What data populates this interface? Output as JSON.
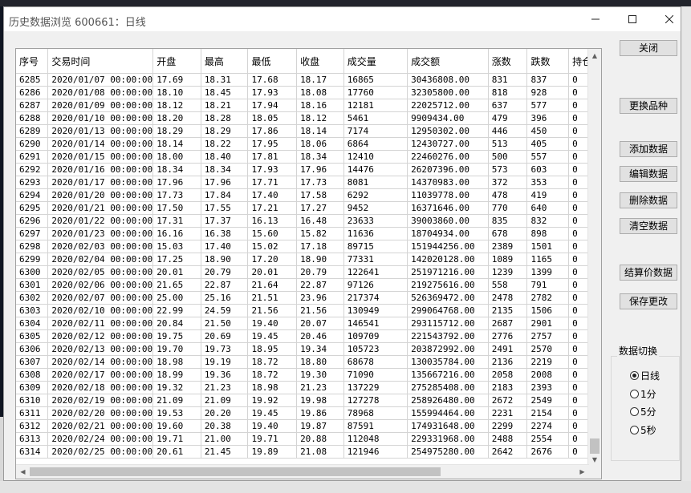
{
  "window": {
    "title": "历史数据浏览 600661：日线",
    "minimize_icon": "minimize-icon",
    "maximize_icon": "maximize-icon",
    "close_icon": "close-icon"
  },
  "table": {
    "columns": [
      "序号",
      "交易时间",
      "开盘",
      "最高",
      "最低",
      "收盘",
      "成交量",
      "成交额",
      "涨数",
      "跌数",
      "持仓"
    ],
    "rows": [
      [
        "6285",
        "2020/01/07 00:00:00",
        "17.69",
        "18.31",
        "17.68",
        "18.17",
        "16865",
        "30436808.00",
        "831",
        "837",
        "0"
      ],
      [
        "6286",
        "2020/01/08 00:00:00",
        "18.10",
        "18.45",
        "17.93",
        "18.08",
        "17760",
        "32305800.00",
        "818",
        "928",
        "0"
      ],
      [
        "6287",
        "2020/01/09 00:00:00",
        "18.12",
        "18.21",
        "17.94",
        "18.16",
        "12181",
        "22025712.00",
        "637",
        "577",
        "0"
      ],
      [
        "6288",
        "2020/01/10 00:00:00",
        "18.20",
        "18.28",
        "18.05",
        "18.12",
        "5461",
        "9909434.00",
        "479",
        "396",
        "0"
      ],
      [
        "6289",
        "2020/01/13 00:00:00",
        "18.29",
        "18.29",
        "17.86",
        "18.14",
        "7174",
        "12950302.00",
        "446",
        "450",
        "0"
      ],
      [
        "6290",
        "2020/01/14 00:00:00",
        "18.14",
        "18.22",
        "17.95",
        "18.06",
        "6864",
        "12430727.00",
        "513",
        "405",
        "0"
      ],
      [
        "6291",
        "2020/01/15 00:00:00",
        "18.00",
        "18.40",
        "17.81",
        "18.34",
        "12410",
        "22460276.00",
        "500",
        "557",
        "0"
      ],
      [
        "6292",
        "2020/01/16 00:00:00",
        "18.34",
        "18.34",
        "17.93",
        "17.96",
        "14476",
        "26207396.00",
        "573",
        "603",
        "0"
      ],
      [
        "6293",
        "2020/01/17 00:00:00",
        "17.96",
        "17.96",
        "17.71",
        "17.73",
        "8081",
        "14370983.00",
        "372",
        "353",
        "0"
      ],
      [
        "6294",
        "2020/01/20 00:00:00",
        "17.73",
        "17.84",
        "17.40",
        "17.58",
        "6292",
        "11039778.00",
        "478",
        "419",
        "0"
      ],
      [
        "6295",
        "2020/01/21 00:00:00",
        "17.50",
        "17.55",
        "17.21",
        "17.27",
        "9452",
        "16371646.00",
        "770",
        "640",
        "0"
      ],
      [
        "6296",
        "2020/01/22 00:00:00",
        "17.31",
        "17.37",
        "16.13",
        "16.48",
        "23633",
        "39003860.00",
        "835",
        "832",
        "0"
      ],
      [
        "6297",
        "2020/01/23 00:00:00",
        "16.16",
        "16.38",
        "15.60",
        "15.82",
        "11636",
        "18704934.00",
        "678",
        "898",
        "0"
      ],
      [
        "6298",
        "2020/02/03 00:00:00",
        "15.03",
        "17.40",
        "15.02",
        "17.18",
        "89715",
        "151944256.00",
        "2389",
        "1501",
        "0"
      ],
      [
        "6299",
        "2020/02/04 00:00:00",
        "17.25",
        "18.90",
        "17.20",
        "18.90",
        "77331",
        "142020128.00",
        "1089",
        "1165",
        "0"
      ],
      [
        "6300",
        "2020/02/05 00:00:00",
        "20.01",
        "20.79",
        "20.01",
        "20.79",
        "122641",
        "251971216.00",
        "1239",
        "1399",
        "0"
      ],
      [
        "6301",
        "2020/02/06 00:00:00",
        "21.65",
        "22.87",
        "21.64",
        "22.87",
        "97126",
        "219275616.00",
        "558",
        "791",
        "0"
      ],
      [
        "6302",
        "2020/02/07 00:00:00",
        "25.00",
        "25.16",
        "21.51",
        "23.96",
        "217374",
        "526369472.00",
        "2478",
        "2782",
        "0"
      ],
      [
        "6303",
        "2020/02/10 00:00:00",
        "22.99",
        "24.59",
        "21.56",
        "21.56",
        "130949",
        "299064768.00",
        "2135",
        "1506",
        "0"
      ],
      [
        "6304",
        "2020/02/11 00:00:00",
        "20.84",
        "21.50",
        "19.40",
        "20.07",
        "146541",
        "293115712.00",
        "2687",
        "2901",
        "0"
      ],
      [
        "6305",
        "2020/02/12 00:00:00",
        "19.75",
        "20.69",
        "19.45",
        "20.46",
        "109709",
        "221543792.00",
        "2776",
        "2757",
        "0"
      ],
      [
        "6306",
        "2020/02/13 00:00:00",
        "19.70",
        "19.73",
        "18.95",
        "19.34",
        "105723",
        "203872992.00",
        "2491",
        "2570",
        "0"
      ],
      [
        "6307",
        "2020/02/14 00:00:00",
        "18.98",
        "19.19",
        "18.72",
        "18.80",
        "68678",
        "130035784.00",
        "2136",
        "2219",
        "0"
      ],
      [
        "6308",
        "2020/02/17 00:00:00",
        "18.99",
        "19.36",
        "18.72",
        "19.30",
        "71090",
        "135667216.00",
        "2058",
        "2008",
        "0"
      ],
      [
        "6309",
        "2020/02/18 00:00:00",
        "19.32",
        "21.23",
        "18.98",
        "21.23",
        "137229",
        "275285408.00",
        "2183",
        "2393",
        "0"
      ],
      [
        "6310",
        "2020/02/19 00:00:00",
        "21.09",
        "21.09",
        "19.92",
        "19.98",
        "127278",
        "258926480.00",
        "2672",
        "2549",
        "0"
      ],
      [
        "6311",
        "2020/02/20 00:00:00",
        "19.53",
        "20.20",
        "19.45",
        "19.86",
        "78968",
        "155994464.00",
        "2231",
        "2154",
        "0"
      ],
      [
        "6312",
        "2020/02/21 00:00:00",
        "19.60",
        "20.38",
        "19.40",
        "19.87",
        "87591",
        "174931648.00",
        "2299",
        "2274",
        "0"
      ],
      [
        "6313",
        "2020/02/24 00:00:00",
        "19.71",
        "21.00",
        "19.71",
        "20.88",
        "112048",
        "229331968.00",
        "2488",
        "2554",
        "0"
      ],
      [
        "6314",
        "2020/02/25 00:00:00",
        "20.61",
        "21.45",
        "19.89",
        "21.08",
        "121946",
        "254975280.00",
        "2642",
        "2676",
        "0"
      ]
    ]
  },
  "buttons": {
    "close": "关闭",
    "change_symbol": "更换品种",
    "add_data": "添加数据",
    "edit_data": "编辑数据",
    "delete_data": "删除数据",
    "clear_data": "清空数据",
    "settlement_data": "结算价数据",
    "save_changes": "保存更改"
  },
  "data_switch": {
    "label": "数据切换",
    "options": [
      "日线",
      "1分",
      "5分",
      "5秒"
    ],
    "selected": "日线"
  }
}
